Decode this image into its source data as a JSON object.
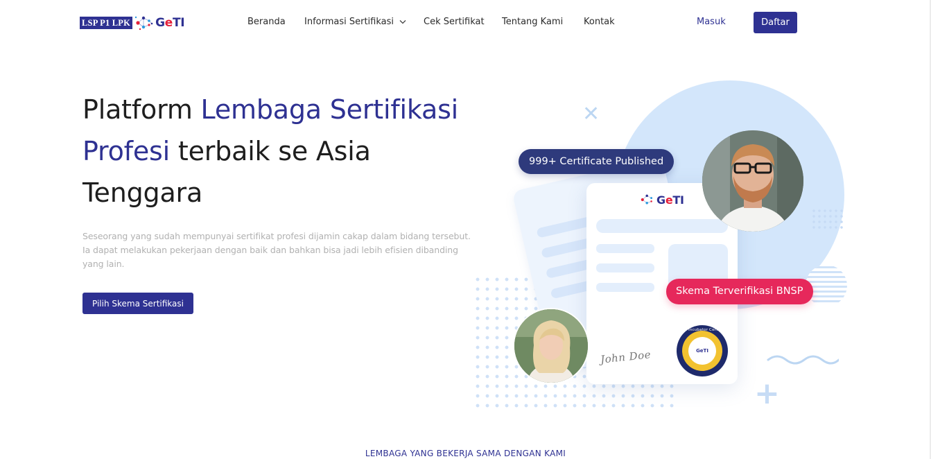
{
  "brand": {
    "box_text": "LSP P1 LPK",
    "name_prefix": "G",
    "name_accent": "e",
    "name_suffix": "TI",
    "primary_color": "#2e3192",
    "accent_color": "#e4213b"
  },
  "nav": {
    "items": [
      {
        "label": "Beranda"
      },
      {
        "label": "Informasi Sertifikasi",
        "has_dropdown": true
      },
      {
        "label": "Cek Sertifikat"
      },
      {
        "label": "Tentang Kami"
      },
      {
        "label": "Kontak"
      }
    ],
    "login_label": "Masuk",
    "register_label": "Daftar"
  },
  "hero": {
    "title_part1": "Platform ",
    "title_accent": "Lembaga Sertifikasi Profesi",
    "title_part2": " terbaik se Asia Tenggara",
    "description": "Seseorang yang sudah mempunyai sertifikat profesi dijamin cakap dalam bidang tersebut. Ia dapat melakukan pekerjaan dengan baik dan bahkan bisa jadi lebih efisien dibanding yang lain.",
    "cta_label": "Pilih Skema Sertifikasi"
  },
  "illustration": {
    "pill_certificates": "999+ Certificate Published",
    "pill_verified": "Skema Terverifikasi BNSP",
    "signature": "John Doe",
    "seal_arc_text": "GeTI Incubator Certified",
    "seal_inner_text": "GeTI",
    "pink_color": "#e6285b",
    "navy_pill_color": "#2e3a7c",
    "circle_color": "#d3e6fb"
  },
  "partners": {
    "heading": "LEMBAGA YANG BEKERJA SAMA DENGAN KAMI"
  }
}
